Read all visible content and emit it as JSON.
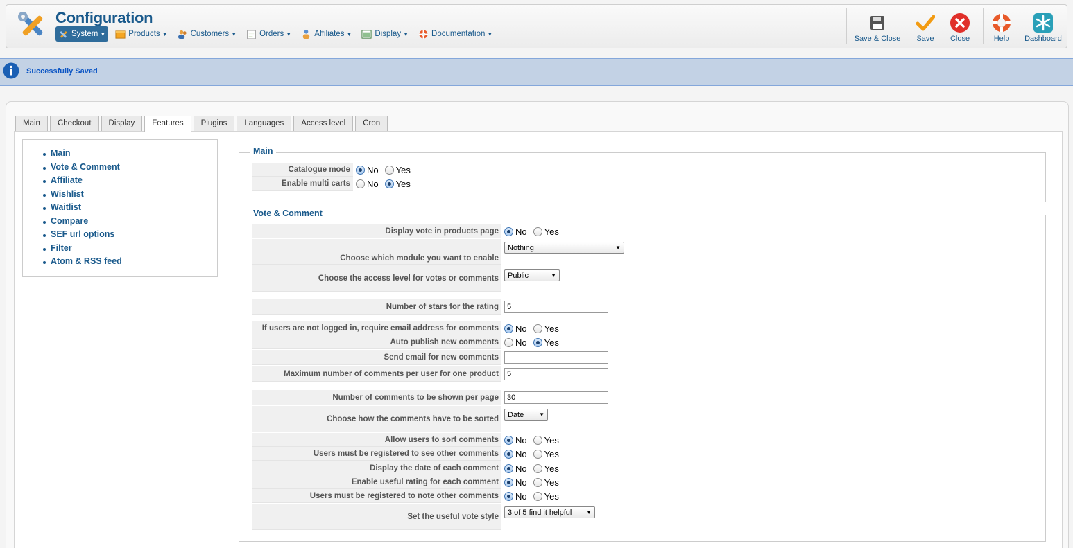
{
  "header": {
    "title": "Configuration",
    "menu": [
      {
        "label": "System",
        "icon": "wrench-icon",
        "active": true
      },
      {
        "label": "Products",
        "icon": "box-icon"
      },
      {
        "label": "Customers",
        "icon": "users-icon"
      },
      {
        "label": "Orders",
        "icon": "orders-icon"
      },
      {
        "label": "Affiliates",
        "icon": "affiliates-icon"
      },
      {
        "label": "Display",
        "icon": "display-icon"
      },
      {
        "label": "Documentation",
        "icon": "lifebuoy-icon"
      }
    ],
    "toolbar": {
      "save_close": "Save & Close",
      "save": "Save",
      "close": "Close",
      "help": "Help",
      "dashboard": "Dashboard"
    }
  },
  "message": {
    "text": "Successfully Saved"
  },
  "tabs": [
    "Main",
    "Checkout",
    "Display",
    "Features",
    "Plugins",
    "Languages",
    "Access level",
    "Cron"
  ],
  "active_tab": "Features",
  "side_nav": [
    "Main",
    "Vote & Comment",
    "Affiliate",
    "Wishlist",
    "Waitlist",
    "Compare",
    "SEF url options",
    "Filter",
    "Atom & RSS feed"
  ],
  "radio_labels": {
    "no": "No",
    "yes": "Yes"
  },
  "sections": {
    "main": {
      "legend": "Main",
      "catalogue_mode": {
        "label": "Catalogue mode",
        "value": "No"
      },
      "multi_carts": {
        "label": "Enable multi carts",
        "value": "Yes"
      }
    },
    "vote": {
      "legend": "Vote & Comment",
      "display_vote": {
        "label": "Display vote in products page",
        "value": "No"
      },
      "module": {
        "label": "Choose which module you want to enable",
        "value": "Nothing"
      },
      "access_level": {
        "label": "Choose the access level for votes or comments",
        "value": "Public"
      },
      "stars": {
        "label": "Number of stars for the rating",
        "value": "5"
      },
      "require_email": {
        "label": "If users are not logged in, require email address for comments",
        "value": "No"
      },
      "auto_publish": {
        "label": "Auto publish new comments",
        "value": "Yes"
      },
      "send_email": {
        "label": "Send email for new comments",
        "value": ""
      },
      "max_comments": {
        "label": "Maximum number of comments per user for one product",
        "value": "5"
      },
      "per_page": {
        "label": "Number of comments to be shown per page",
        "value": "30"
      },
      "sort_by": {
        "label": "Choose how the comments have to be sorted",
        "value": "Date"
      },
      "allow_sort": {
        "label": "Allow users to sort comments",
        "value": "No"
      },
      "registered_see": {
        "label": "Users must be registered to see other comments",
        "value": "No"
      },
      "display_date": {
        "label": "Display the date of each comment",
        "value": "No"
      },
      "useful_rating": {
        "label": "Enable useful rating for each comment",
        "value": "No"
      },
      "registered_note": {
        "label": "Users must be registered to note other comments",
        "value": "No"
      },
      "vote_style": {
        "label": "Set the useful vote style",
        "value": "3 of 5 find it helpful"
      }
    }
  }
}
